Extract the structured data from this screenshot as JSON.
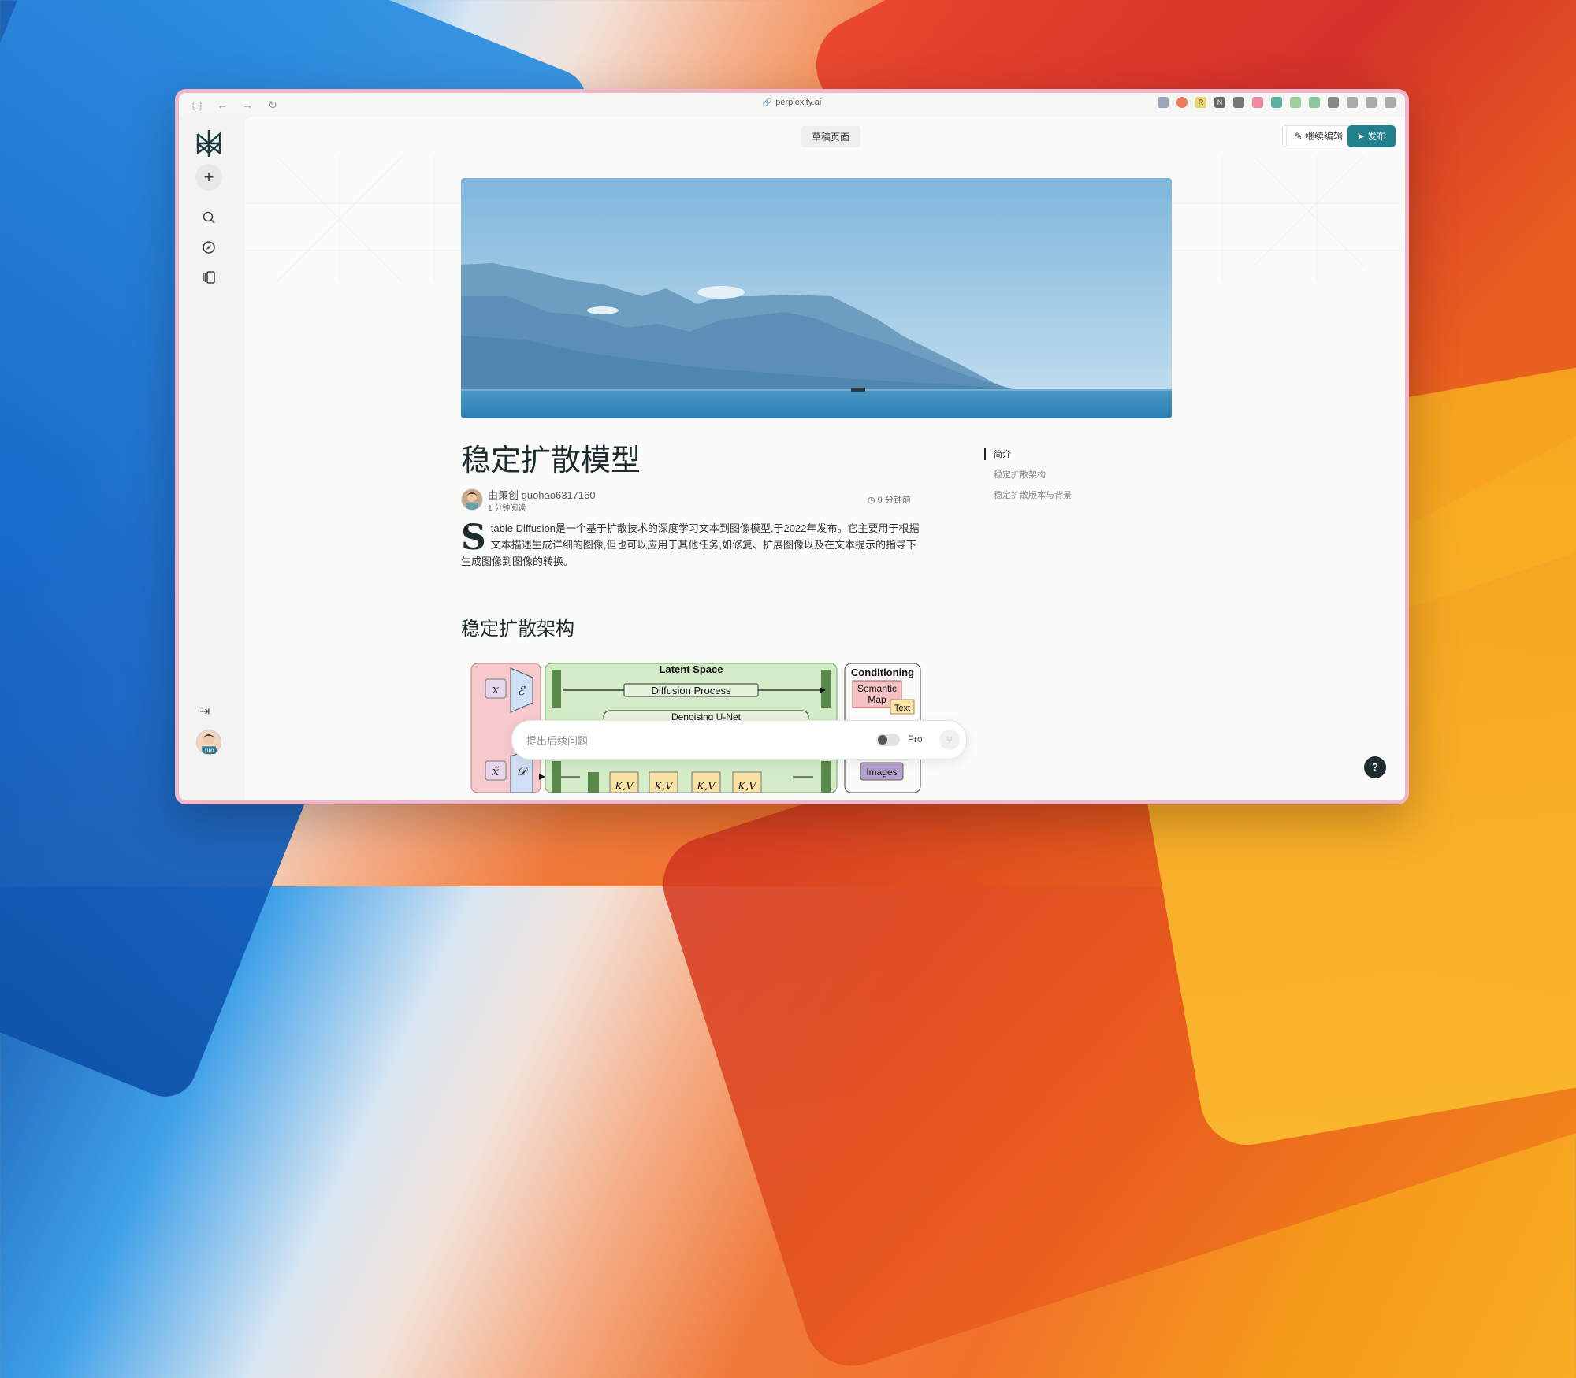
{
  "browser": {
    "url": "perplexity.ai"
  },
  "sidebar": {
    "new_thread": "+",
    "avatar_badge": "pro"
  },
  "topbar": {
    "draft_tab": "草稿页面",
    "more": "···",
    "edit_label": "继续编辑",
    "publish_label": "发布"
  },
  "article": {
    "title": "稳定扩散模型",
    "author": "由策创 guohao6317160",
    "read_time": "1 分钟阅读",
    "updated": "9 分钟前",
    "intro_dropcap": "S",
    "intro_text": "table Diffusion是一个基于扩散技术的深度学习文本到图像模型,于2022年发布。它主要用于根据文本描述生成详细的图像,但也可以应用于其他任务,如修复、扩展图像以及在文本提示的指导下生成图像到图像的转换。",
    "section_heading": "稳定扩散架构"
  },
  "toc": {
    "items": [
      {
        "label": "简介",
        "active": true
      },
      {
        "label": "稳定扩散架构",
        "active": false
      },
      {
        "label": "稳定扩散版本与背景",
        "active": false
      }
    ]
  },
  "diagram": {
    "latent_space": "Latent Space",
    "diffusion_process": "Diffusion Process",
    "denoising": "Denoising U-Net",
    "conditioning": "Conditioning",
    "semantic": "Semantic",
    "map": "Map",
    "text": "Text",
    "images": "Images",
    "kv": "K,V"
  },
  "followup": {
    "placeholder": "提出后续问题",
    "pro_label": "Pro"
  },
  "help": "?"
}
